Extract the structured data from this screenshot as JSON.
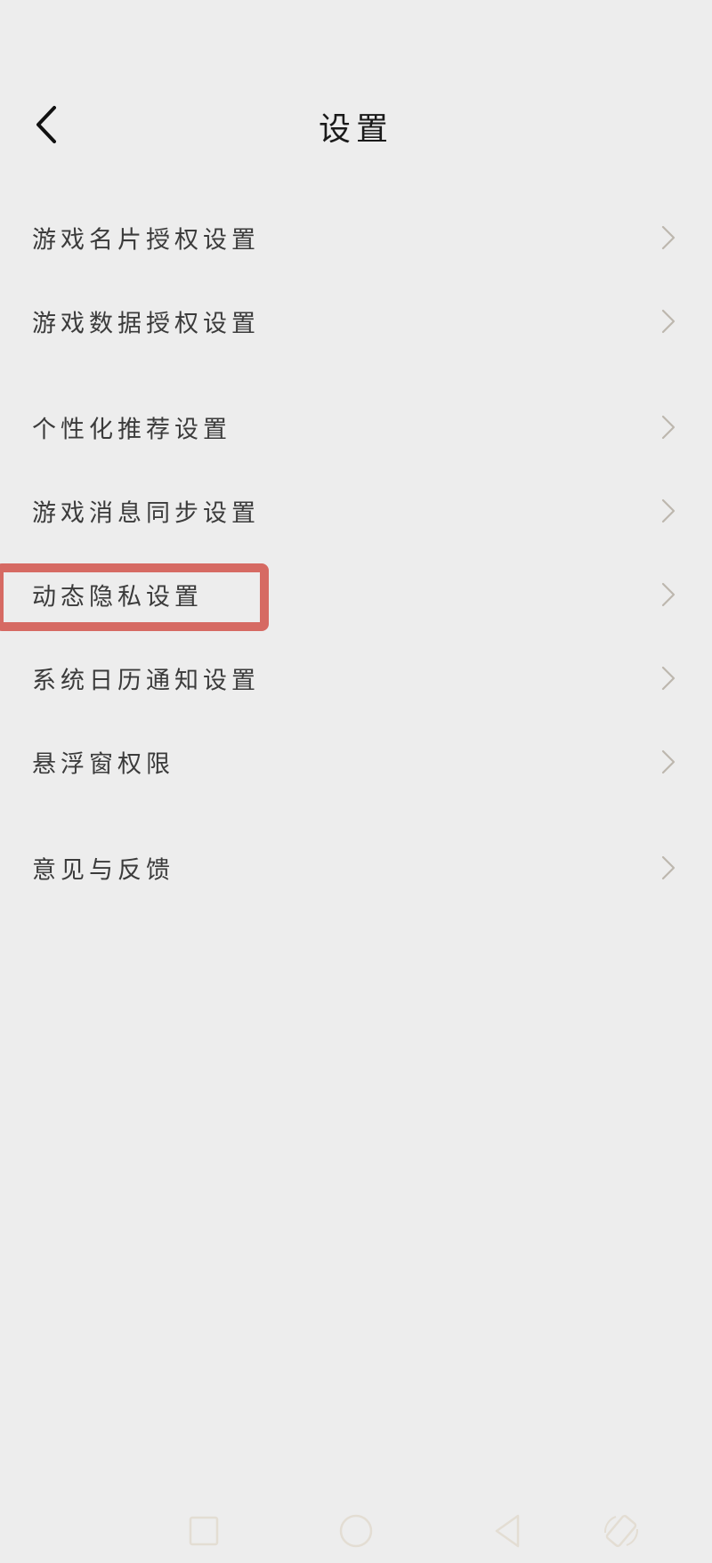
{
  "header": {
    "title": "设置",
    "back_icon": "chevron-left-icon"
  },
  "settings": {
    "items": [
      {
        "label": "游戏名片授权设置"
      },
      {
        "label": "游戏数据授权设置"
      },
      {
        "label": "个性化推荐设置"
      },
      {
        "label": "游戏消息同步设置"
      },
      {
        "label": "动态隐私设置"
      },
      {
        "label": "系统日历通知设置"
      },
      {
        "label": "悬浮窗权限"
      },
      {
        "label": "意见与反馈"
      }
    ],
    "chevron_icon": "chevron-right-icon"
  },
  "highlight": {
    "target": "动态隐私设置",
    "color": "#d66a63"
  },
  "nav_bar": {
    "buttons": [
      "recent-apps-icon",
      "home-icon",
      "back-triangle-icon",
      "rotate-icon"
    ],
    "color": "#e3ddd3"
  },
  "colors": {
    "background": "#ededed",
    "text": "#3b3b3b",
    "chevron": "#bdb7ae"
  }
}
